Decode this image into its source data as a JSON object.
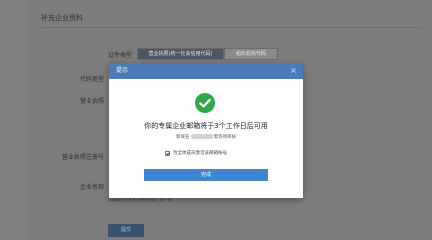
{
  "background_page": {
    "title": "补充企业资料",
    "fields": {
      "cert_type": "证件类型",
      "code_type": "代码类型",
      "business_license": "营业执照",
      "license_reg_no": "营业执照注册号",
      "company_name": "企业名称"
    },
    "cert_options": [
      "营业执照(统一社会信用代码)",
      "组织机构代码"
    ],
    "hint": "请确保企业名称与营业执照上的一致",
    "submit_label": "提交"
  },
  "dialog": {
    "header": "提示",
    "close_icon": "×",
    "main_message": "你的专属企业邮箱将于3个工作日后可用",
    "sub_prefix": "新域名",
    "sub_suffix": "需等待审核",
    "checkbox_label": "为全体成员激活该邮箱帐号",
    "done_button": "完成",
    "icon": "check-circle-icon",
    "accent_color": "#4c79b8",
    "success_color": "#2fa84a"
  }
}
